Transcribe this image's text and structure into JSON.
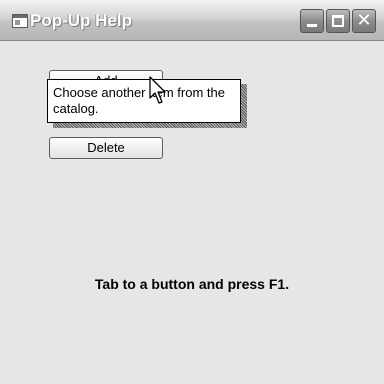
{
  "window": {
    "title": "Pop-Up Help"
  },
  "buttons": {
    "add_label": "Add",
    "delete_label": "Delete"
  },
  "tooltip": {
    "text": "Choose another item from the catalog."
  },
  "instruction": {
    "text": "Tab to a button and press F1."
  },
  "icons": {
    "app": "app-window-icon",
    "minimize": "minimize-icon",
    "maximize": "maximize-icon",
    "close": "close-icon",
    "cursor": "mouse-pointer-icon"
  },
  "colors": {
    "window_background": "#e6e6e6",
    "tooltip_background": "#ffffff",
    "caption_button": "#8c8c8c"
  }
}
